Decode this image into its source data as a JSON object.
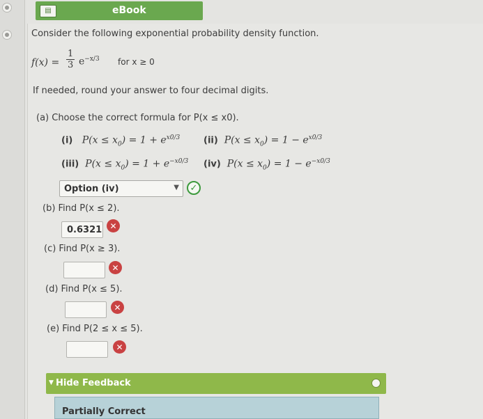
{
  "ebook": {
    "label": "eBook"
  },
  "problem": {
    "intro": "Consider the following exponential probability density function.",
    "fx_lhs": "f(x) =",
    "fx_num": "1",
    "fx_den": "3",
    "fx_exp_base": "e",
    "fx_exp_power": "−x/3",
    "fx_domain": "for x ≥ 0",
    "rounding": "If needed, round your answer to four decimal digits."
  },
  "part_a": {
    "prompt": "(a) Choose the correct formula for P(x ≤ x0).",
    "options": [
      {
        "tag": "(i)",
        "formula": "P(x ≤ x",
        "sub": "0",
        "rest": ") = 1 + e",
        "exp": "x0/3"
      },
      {
        "tag": "(ii)",
        "formula": "P(x ≤ x",
        "sub": "0",
        "rest": ") = 1 − e",
        "exp": "x0/3"
      },
      {
        "tag": "(iii)",
        "formula": "P(x ≤ x",
        "sub": "0",
        "rest": ") = 1 + e",
        "exp": "−x0/3"
      },
      {
        "tag": "(iv)",
        "formula": "P(x ≤ x",
        "sub": "0",
        "rest": ") = 1 − e",
        "exp": "−x0/3"
      }
    ],
    "selected": "Option (iv)"
  },
  "part_b": {
    "prompt": "(b) Find P(x ≤ 2).",
    "answer": "0.6321"
  },
  "part_c": {
    "prompt": "(c) Find P(x ≥ 3).",
    "answer": ""
  },
  "part_d": {
    "prompt": "(d) Find P(x ≤ 5).",
    "answer": ""
  },
  "part_e": {
    "prompt": "(e) Find P(2 ≤ x ≤ 5).",
    "answer": ""
  },
  "feedback": {
    "toggle_label": "Hide Feedback",
    "status": "Partially Correct"
  },
  "colors": {
    "ebook_green": "#6aa84f",
    "feedback_green": "#8fb84a",
    "correct": "#3d9a3d",
    "incorrect": "#c94242",
    "partial_bg": "#b7d2d8"
  }
}
